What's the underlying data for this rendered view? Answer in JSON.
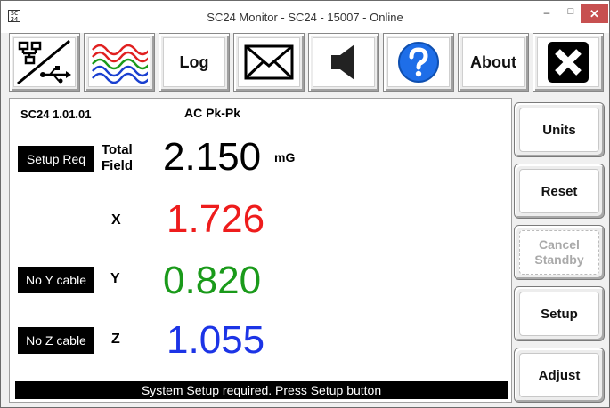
{
  "window": {
    "icon_text": "SC\n24",
    "title": "SC24 Monitor - SC24 - 15007 - Online",
    "minimize": "–",
    "maximize": "□",
    "close": "✕"
  },
  "toolbar": {
    "buttons": [
      {
        "name": "connection",
        "icon": "network-usb-icon"
      },
      {
        "name": "waveform",
        "icon": "waveform-icon",
        "colors": [
          "#e02020",
          "#1a9a1a",
          "#1a40d0"
        ]
      },
      {
        "name": "log",
        "label": "Log"
      },
      {
        "name": "email",
        "icon": "envelope-icon"
      },
      {
        "name": "sound",
        "icon": "speaker-icon"
      },
      {
        "name": "help",
        "icon": "help-icon",
        "color": "#1e6ee8"
      },
      {
        "name": "about",
        "label": "About"
      },
      {
        "name": "exit",
        "icon": "exit-icon"
      }
    ]
  },
  "main": {
    "firmware": "SC24 1.01.01",
    "mode": "AC Pk-Pk",
    "setup_tag": "Setup Req",
    "total_label_line1": "Total",
    "total_label_line2": "Field",
    "total_value": "2.150",
    "unit": "mG",
    "x_label": "X",
    "x_value": "1.726",
    "y_tag": "No Y cable",
    "y_label": "Y",
    "y_value": "0.820",
    "z_tag": "No Z cable",
    "z_label": "Z",
    "z_value": "1.055",
    "status": "System Setup required. Press Setup button",
    "colors": {
      "total": "#000000",
      "x": "#ee1c1c",
      "y": "#1a9a1a",
      "z": "#1c34e6"
    }
  },
  "side": {
    "units": "Units",
    "reset": "Reset",
    "cancel_line1": "Cancel",
    "cancel_line2": "Standby",
    "setup": "Setup",
    "adjust": "Adjust"
  }
}
